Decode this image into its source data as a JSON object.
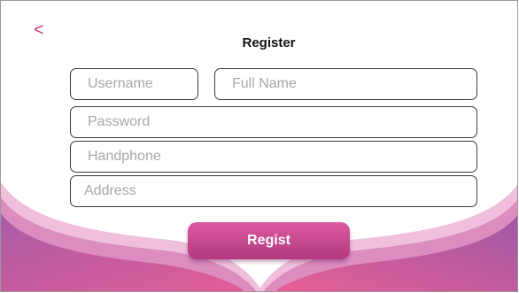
{
  "header": {
    "back_glyph": "<",
    "title": "Register"
  },
  "form": {
    "username": {
      "placeholder": "Username"
    },
    "full_name": {
      "placeholder": "Full Name"
    },
    "password": {
      "placeholder": "Password"
    },
    "handphone": {
      "placeholder": "Handphone"
    },
    "address": {
      "placeholder": "Address"
    }
  },
  "submit": {
    "label": "Regist"
  },
  "colors": {
    "accent": "#c0407f",
    "wave_light": "#eab3d4",
    "wave_mid": "#d978b0",
    "wave_dark": "#a75aa6",
    "wave_pink": "#e05c98"
  }
}
